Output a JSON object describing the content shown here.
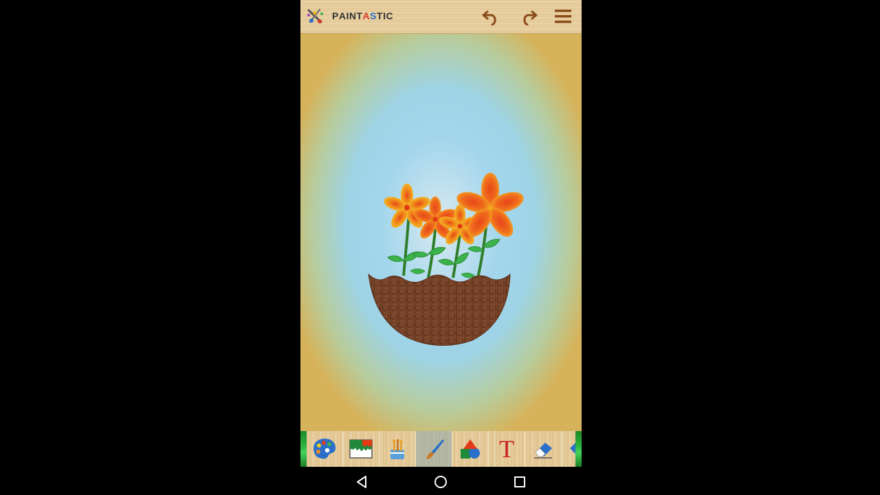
{
  "app": {
    "title_letters": [
      {
        "ch": "P",
        "color": "#333333"
      },
      {
        "ch": "A",
        "color": "#333333"
      },
      {
        "ch": "I",
        "color": "#333333"
      },
      {
        "ch": "N",
        "color": "#333333"
      },
      {
        "ch": "T",
        "color": "#333333"
      },
      {
        "ch": "A",
        "color": "#d23a2a"
      },
      {
        "ch": "S",
        "color": "#2a6fc9"
      },
      {
        "ch": "T",
        "color": "#333333"
      },
      {
        "ch": "I",
        "color": "#333333"
      },
      {
        "ch": "C",
        "color": "#333333"
      }
    ],
    "logo_icon": "paintbrush-splash-icon"
  },
  "appbar": {
    "actions": [
      {
        "name": "undo-icon",
        "color": "#8a4b1a"
      },
      {
        "name": "redo-icon",
        "color": "#8a4b1a"
      },
      {
        "name": "hamburger-menu-icon",
        "color": "#8a4b1a"
      }
    ]
  },
  "canvas": {
    "drawing": "flower-basket",
    "colors": {
      "petal_outer": "#f2a11d",
      "petal_inner": "#e8461a",
      "leaf": "#3cb34a",
      "stem": "#2f7d2a",
      "basket": "#6b3a22",
      "basket_weave": "#8c5536"
    }
  },
  "toolbar": {
    "tools": [
      {
        "name": "color-palette-icon",
        "selected": false
      },
      {
        "name": "background-fill-icon",
        "selected": false
      },
      {
        "name": "brush-set-icon",
        "selected": false
      },
      {
        "name": "paintbrush-icon",
        "selected": true
      },
      {
        "name": "shapes-icon",
        "selected": false
      },
      {
        "name": "text-tool-icon",
        "selected": false,
        "label": "T"
      },
      {
        "name": "eraser-icon",
        "selected": false
      }
    ]
  },
  "navbar": {
    "buttons": [
      "back-icon",
      "home-icon",
      "recents-icon"
    ]
  }
}
